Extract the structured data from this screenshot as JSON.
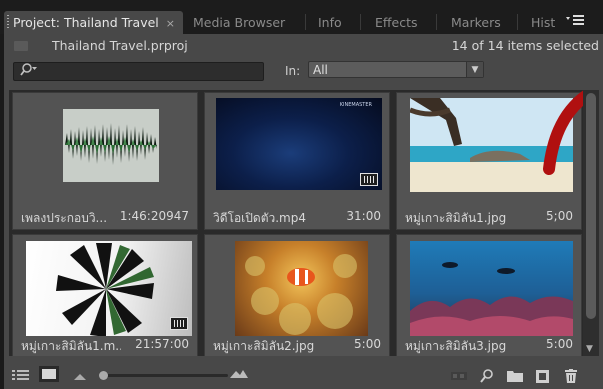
{
  "tabs": [
    {
      "label": "Project: Thailand Travel",
      "close": "×",
      "active": true
    },
    {
      "label": "Media Browser"
    },
    {
      "label": "Info"
    },
    {
      "label": "Effects"
    },
    {
      "label": "Markers"
    },
    {
      "label": "Hist"
    }
  ],
  "panel_menu_icon": "hamburger-menu-icon",
  "project": {
    "file_name": "Thailand Travel.prproj",
    "selection_count": "14 of 14 items selected"
  },
  "search": {
    "value": "",
    "in_label": "In:",
    "in_value": "All"
  },
  "items": [
    {
      "name": "เพลงประกอบวิ...",
      "duration": "1:46:20947",
      "kind": "audio"
    },
    {
      "name": "วิดีโอเปิดตัว.mp4",
      "duration": "31:00",
      "kind": "video",
      "thumb_text": "KINEMASTER"
    },
    {
      "name": "หมู่เกาะสิมิลัน1.jpg",
      "duration": "5;00",
      "kind": "image"
    },
    {
      "name": "หมู่เกาะสิมิลัน1.m...",
      "duration": "21:57:00",
      "kind": "video"
    },
    {
      "name": "หมู่เกาะสิมิลัน2.jpg",
      "duration": "5:00",
      "kind": "image"
    },
    {
      "name": "หมู่เกาะสิมิลัน3.jpg",
      "duration": "5:00",
      "kind": "image"
    }
  ],
  "footer_icons": [
    "list-view-icon",
    "icon-view-icon",
    "zoom-out-icon",
    "zoom-in-icon",
    "automate-to-sequence-icon",
    "find-icon",
    "new-bin-icon",
    "new-item-icon",
    "delete-icon"
  ],
  "colors": {
    "panel": "#484848",
    "active_tab": "#484848",
    "accent_red": "#b01010"
  }
}
